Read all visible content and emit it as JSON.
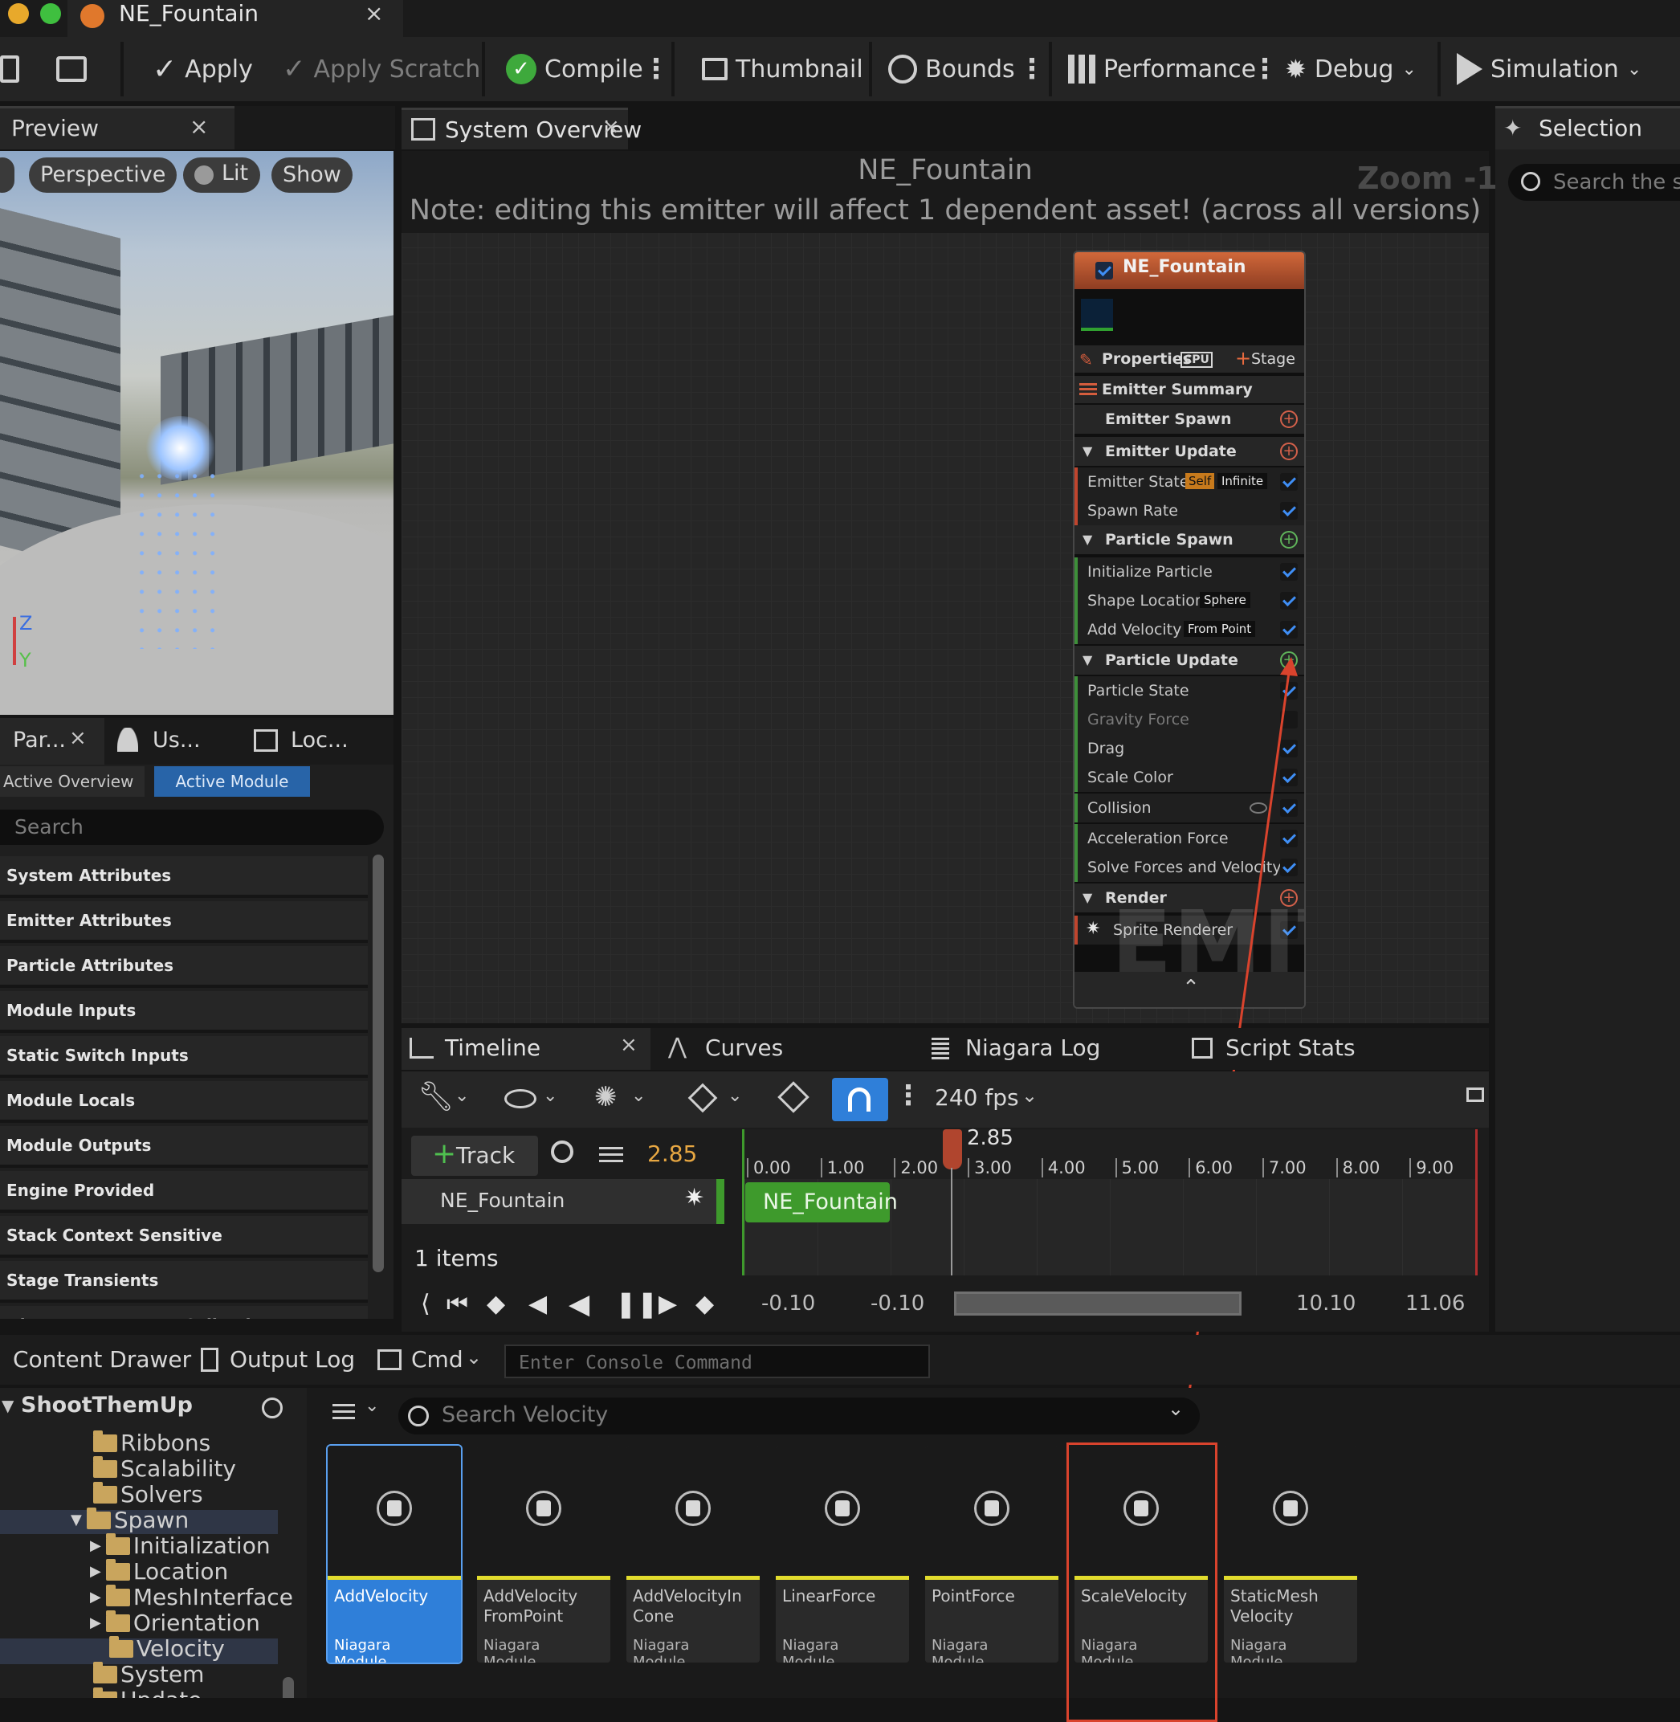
{
  "window": {
    "tab_title": "NE_Fountain"
  },
  "toolbar": {
    "apply": "Apply",
    "apply_scratch": "Apply Scratch",
    "compile": "Compile",
    "thumbnail": "Thumbnail",
    "bounds": "Bounds",
    "performance": "Performance",
    "debug": "Debug",
    "simulation": "Simulation"
  },
  "preview": {
    "tab": "Preview",
    "perspective": "Perspective",
    "lit": "Lit",
    "show": "Show",
    "axis_z": "Z",
    "axis_y": "Y"
  },
  "overview": {
    "tab": "System Overview",
    "title": "NE_Fountain",
    "note": "Note: editing this emitter will affect 1 dependent asset! (across all versions)",
    "zoom": "Zoom -1",
    "watermark": "EMITTER"
  },
  "emitter_node": {
    "name": "NE_Fountain",
    "properties": "Properties",
    "cpu": "CPU",
    "stage": "Stage",
    "summary": "Emitter Summary",
    "rows": [
      {
        "label": "Emitter Spawn",
        "kind": "group-plain"
      },
      {
        "label": "Emitter Update",
        "kind": "group"
      },
      {
        "label": "Emitter State",
        "tag1": "Self",
        "tag2": "Infinite",
        "checked": true
      },
      {
        "label": "Spawn Rate",
        "checked": true
      },
      {
        "label": "Particle Spawn",
        "kind": "group"
      },
      {
        "label": "Initialize Particle",
        "checked": true
      },
      {
        "label": "Shape Location",
        "tag2": "Sphere",
        "checked": true
      },
      {
        "label": "Add Velocity",
        "tag2": "From Point",
        "checked": true
      },
      {
        "label": "Particle Update",
        "kind": "group"
      },
      {
        "label": "Particle State",
        "checked": true
      },
      {
        "label": "Gravity Force",
        "checked": false
      },
      {
        "label": "Drag",
        "checked": true
      },
      {
        "label": "Scale Color",
        "checked": true
      },
      {
        "label": "Collision",
        "checked": true
      },
      {
        "label": "Acceleration Force",
        "checked": true
      },
      {
        "label": "Solve Forces and Velocity",
        "checked": true
      },
      {
        "label": "Render",
        "kind": "group"
      },
      {
        "label": "Sprite Renderer",
        "checked": true
      }
    ]
  },
  "params_panel": {
    "tab1": "Par...",
    "tab2": "Us...",
    "tab3": "Loc...",
    "active_overview": "Active Overview",
    "active_module": "Active Module",
    "search_placeholder": "Search",
    "items": [
      "System Attributes",
      "Emitter Attributes",
      "Particle Attributes",
      "Module Inputs",
      "Static Switch Inputs",
      "Module Locals",
      "Module Outputs",
      "Engine Provided",
      "Stack Context Sensitive",
      "Stage Transients",
      "Niagara Parameter Collection"
    ]
  },
  "timeline": {
    "tabs": [
      "Timeline",
      "Curves",
      "Niagara Log",
      "Script Stats"
    ],
    "fps": "240 fps",
    "track_button": "Track",
    "current_time": "2.85",
    "ticks": [
      "0.00",
      "1.00",
      "2.00",
      "3.00",
      "4.00",
      "5.00",
      "6.00",
      "7.00",
      "8.00",
      "9.00"
    ],
    "playhead_label": "2.85",
    "track_name": "NE_Fountain",
    "clip_name": "NE_Fountain",
    "items_count": "1 items",
    "range_start_a": "-0.10",
    "range_start_b": "-0.10",
    "range_end_a": "10.10",
    "range_end_b": "11.06"
  },
  "selection_panel": {
    "tab": "Selection",
    "search_placeholder": "Search the st"
  },
  "bottom_bar": {
    "content_drawer": "Content Drawer",
    "output_log": "Output Log",
    "cmd": "Cmd",
    "console_placeholder": "Enter Console Command"
  },
  "content_browser": {
    "root": "ShootThemUp",
    "search_placeholder": "Search Velocity",
    "folders": [
      "Ribbons",
      "Scalability",
      "Solvers",
      "Spawn",
      "Initialization",
      "Location",
      "MeshInterface",
      "Orientation",
      "Velocity",
      "System",
      "Update"
    ],
    "assets": [
      {
        "name": "AddVelocity",
        "type": "Niagara Module..."
      },
      {
        "name": "AddVelocity\nFromPoint",
        "type": "Niagara Module..."
      },
      {
        "name": "AddVelocityIn\nCone",
        "type": "Niagara Module..."
      },
      {
        "name": "LinearForce",
        "type": "Niagara Module..."
      },
      {
        "name": "PointForce",
        "type": "Niagara Module..."
      },
      {
        "name": "ScaleVelocity",
        "type": "Niagara Module..."
      },
      {
        "name": "StaticMesh\nVelocity",
        "type": "Niagara Module..."
      }
    ]
  },
  "colors": {
    "accent_blue": "#2f7fd9",
    "highlight_red": "#d9432d",
    "clip_green": "#3e9a2c",
    "module_yellow": "#e2dc2d",
    "emitter_orange": "#c2562f"
  }
}
